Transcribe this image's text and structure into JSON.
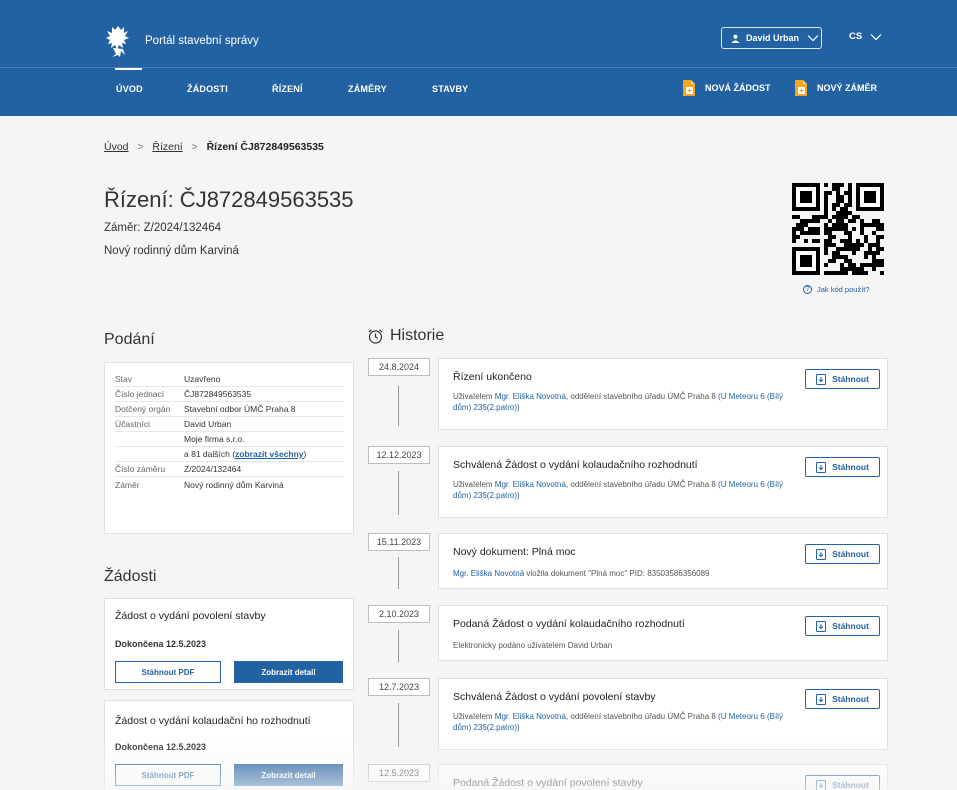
{
  "header": {
    "brand": "Portál stavební správy",
    "user_name": "David Urban",
    "lang": "CS"
  },
  "nav": {
    "items": [
      "ÚVOD",
      "ŽÁDOSTI",
      "ŘÍZENÍ",
      "ZÁMĚRY",
      "STAVBY"
    ],
    "active": "ÚVOD",
    "actions": [
      "NOVÁ ŽÁDOST",
      "NOVÝ ZÁMĚR"
    ]
  },
  "breadcrumb": {
    "items": [
      "Úvod",
      "Řízení"
    ],
    "current": "Řízení ČJ872849563535"
  },
  "page": {
    "title": "Řízení: ČJ872849563535",
    "zamer": "Záměr: Z/2024/132464",
    "zamer_name": "Nový rodinný dům Karviná",
    "qr_help": "Jak kód použít?"
  },
  "podani": {
    "heading": "Podání",
    "rows": [
      {
        "label": "Stav",
        "value": "Uzavřeno"
      },
      {
        "label": "Číslo jednací",
        "value": "ČJ872849563535"
      },
      {
        "label": "Dotčený orgán",
        "value": "Stavební odbor ÚMČ Praha 8"
      },
      {
        "label": "Účastníci",
        "value": "David Urban"
      },
      {
        "label": "",
        "value": "Moje firma s.r.o."
      },
      {
        "label": "",
        "value": "a 81 dalších (",
        "link": "zobrazit všechny",
        "suffix": ")"
      },
      {
        "label": "Číslo záměru",
        "value": "Z/2024/132464"
      },
      {
        "label": "Záměr",
        "value": "Nový rodinný dům Karviná"
      }
    ]
  },
  "zadosti": {
    "heading": "Žádosti",
    "items": [
      {
        "title": "Žádost o vydání povolení stavby",
        "status": "Dokončena 12.5.2023",
        "btn_pdf": "Stáhnout PDF",
        "btn_detail": "Zobrazit detail"
      },
      {
        "title": "Žádost o vydání kolaudační ho rozhodnutí",
        "status": "Dokončena 12.5.2023",
        "btn_pdf": "Stáhnout PDF",
        "btn_detail": "Zobrazit detail"
      }
    ]
  },
  "historie": {
    "heading": "Historie",
    "download_label": "Stáhnout",
    "entries": [
      {
        "date": "24.8.2024",
        "title": "Řízení ukončeno",
        "pre": "Uživatelem ",
        "link": "Mgr. Eliška Novotná",
        "mid": ", oddělení stavebního úřadu ÚMČ Praha 8 ",
        "link2": "(U Meteoru 6 (Bílý dům) 235(2.patro))"
      },
      {
        "date": "12.12.2023",
        "title": "Schválená Žádost o vydání kolaudačního rozhodnutí",
        "pre": "Uživatelem ",
        "link": "Mgr. Eliška Novotná",
        "mid": ", oddělení stavebního úřadu ÚMČ Praha 8 ",
        "link2": "(U Meteoru 6 (Bílý dům) 235(2.patro))"
      },
      {
        "date": "15.11.2023",
        "title": "Nový dokument: Plná moc",
        "pre": "",
        "link": "Mgr. Eliška Novotná",
        "mid": " vložila dokument \"Plná moc\" PID: 83503586356089",
        "link2": ""
      },
      {
        "date": "2.10.2023",
        "title": "Podaná Žádost o vydání kolaudačního rozhodnutí",
        "pre": "Elektronicky podáno uživatelem David Urban",
        "link": "",
        "mid": "",
        "link2": ""
      },
      {
        "date": "12.7.2023",
        "title": "Schválená Žádost o vydání povolení stavby",
        "pre": "Uživatelem ",
        "link": "Mgr. Eliška Novotná",
        "mid": ", oddělení stavebního úřadu ÚMČ Praha 8 ",
        "link2": "(U Meteoru 6 (Bílý dům) 235(2.patro))"
      },
      {
        "date": "12.5.2023",
        "title": "Podaná Žádost o vydání povolení stavby",
        "pre": "",
        "link": "",
        "mid": "",
        "link2": ""
      }
    ]
  },
  "colors": {
    "primary": "#2362a2",
    "background": "#f5f5f5",
    "card": "#ffffff"
  }
}
